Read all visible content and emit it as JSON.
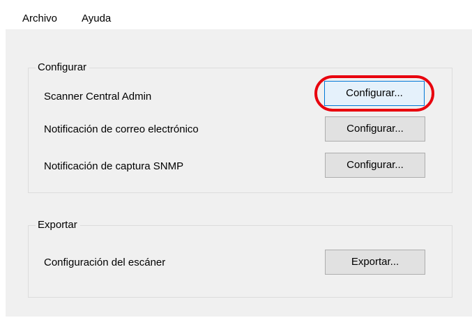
{
  "menu": {
    "items": [
      {
        "label": "Archivo"
      },
      {
        "label": "Ayuda"
      }
    ]
  },
  "configure_group": {
    "title": "Configurar",
    "rows": [
      {
        "label": "Scanner Central Admin",
        "button": "Configurar...",
        "focused": true
      },
      {
        "label": "Notificación de correo electrónico",
        "button": "Configurar..."
      },
      {
        "label": "Notificación de captura SNMP",
        "button": "Configurar..."
      }
    ]
  },
  "export_group": {
    "title": "Exportar",
    "rows": [
      {
        "label": "Configuración del escáner",
        "button": "Exportar..."
      }
    ]
  },
  "colors": {
    "window_bg": "#f0f0f0",
    "focus_border": "#0078d7",
    "annotation_ring": "#e8000d"
  }
}
